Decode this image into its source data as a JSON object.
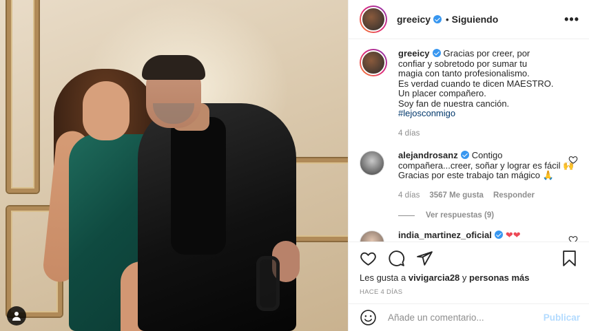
{
  "post": {
    "username": "greeicy",
    "follow_status": "Siguiendo",
    "dot": "•",
    "more": "•••",
    "caption_lines": [
      "Gracias por creer, por",
      "confiar y sobretodo por sumar tu",
      "magia con tanto profesionalismo.",
      "Es verdad cuando te dicen MAESTRO.",
      "Un placer compañero.",
      "Soy fan de nuestra canción."
    ],
    "hashtag": "#lejosconmigo",
    "caption_time": "4 días"
  },
  "comments": [
    {
      "username": "alejandrosanz",
      "text": "Contigo compañera...creer, soñar y lograr es fácil 🙌 Gracias por este trabajo tan mágico 🙏",
      "time": "4 días",
      "likes": "3567 Me gusta",
      "reply_label": "Responder",
      "view_replies": "Ver respuestas (9)"
    },
    {
      "username": "india_martinez_oficial",
      "text": "❤❤"
    }
  ],
  "actions": {
    "likes_prefix": "Les gusta a",
    "liked_by": "vivigarcia28",
    "likes_middle": "y",
    "likes_others": "personas más",
    "posted_time": "HACE 4 DÍAS"
  },
  "add_comment": {
    "placeholder": "Añade un comentario...",
    "publish": "Publicar"
  },
  "colors": {
    "verified": "#3897f0",
    "link": "#00376b",
    "muted": "#8e8e8e",
    "publish_disabled": "#b3dbff",
    "heart_red": "#ed4956"
  },
  "icons": [
    "verified-badge-icon",
    "heart-icon",
    "comment-icon",
    "share-icon",
    "bookmark-icon",
    "emoji-icon",
    "user-tag-icon"
  ]
}
